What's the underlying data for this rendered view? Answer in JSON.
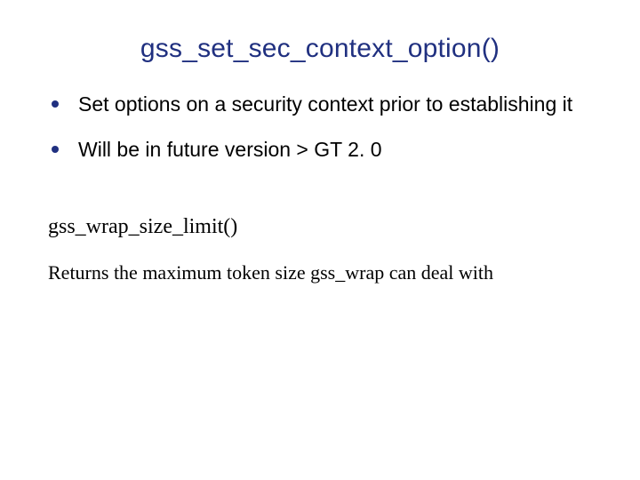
{
  "title": "gss_set_sec_context_option()",
  "bullets": [
    "Set options on a security context prior to establishing it",
    "Will be in future version > GT 2. 0"
  ],
  "subheading": "gss_wrap_size_limit()",
  "body": "Returns the maximum token size gss_wrap can deal with"
}
